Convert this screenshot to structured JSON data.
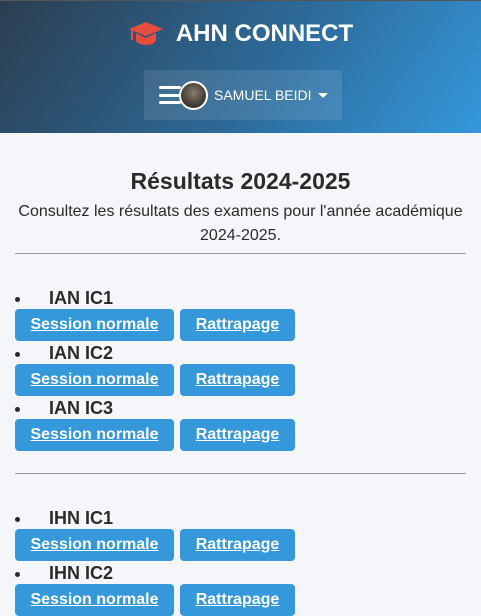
{
  "header": {
    "title": "AHN CONNECT",
    "user": "SAMUEL BEIDI"
  },
  "page": {
    "title": "Résultats 2024-2025",
    "intro": "Consultez les résultats des examens pour l'année académique 2024-2025."
  },
  "groups": [
    [
      {
        "label": "IAN IC1"
      },
      {
        "label": "IAN IC2"
      },
      {
        "label": "IAN IC3"
      }
    ],
    [
      {
        "label": "IHN IC1"
      },
      {
        "label": "IHN IC2"
      }
    ]
  ],
  "buttons": {
    "normal": "Session normale",
    "rattrapage": "Rattrapage"
  },
  "colors": {
    "accent": "#3498db",
    "logo": "#e74c3c"
  }
}
